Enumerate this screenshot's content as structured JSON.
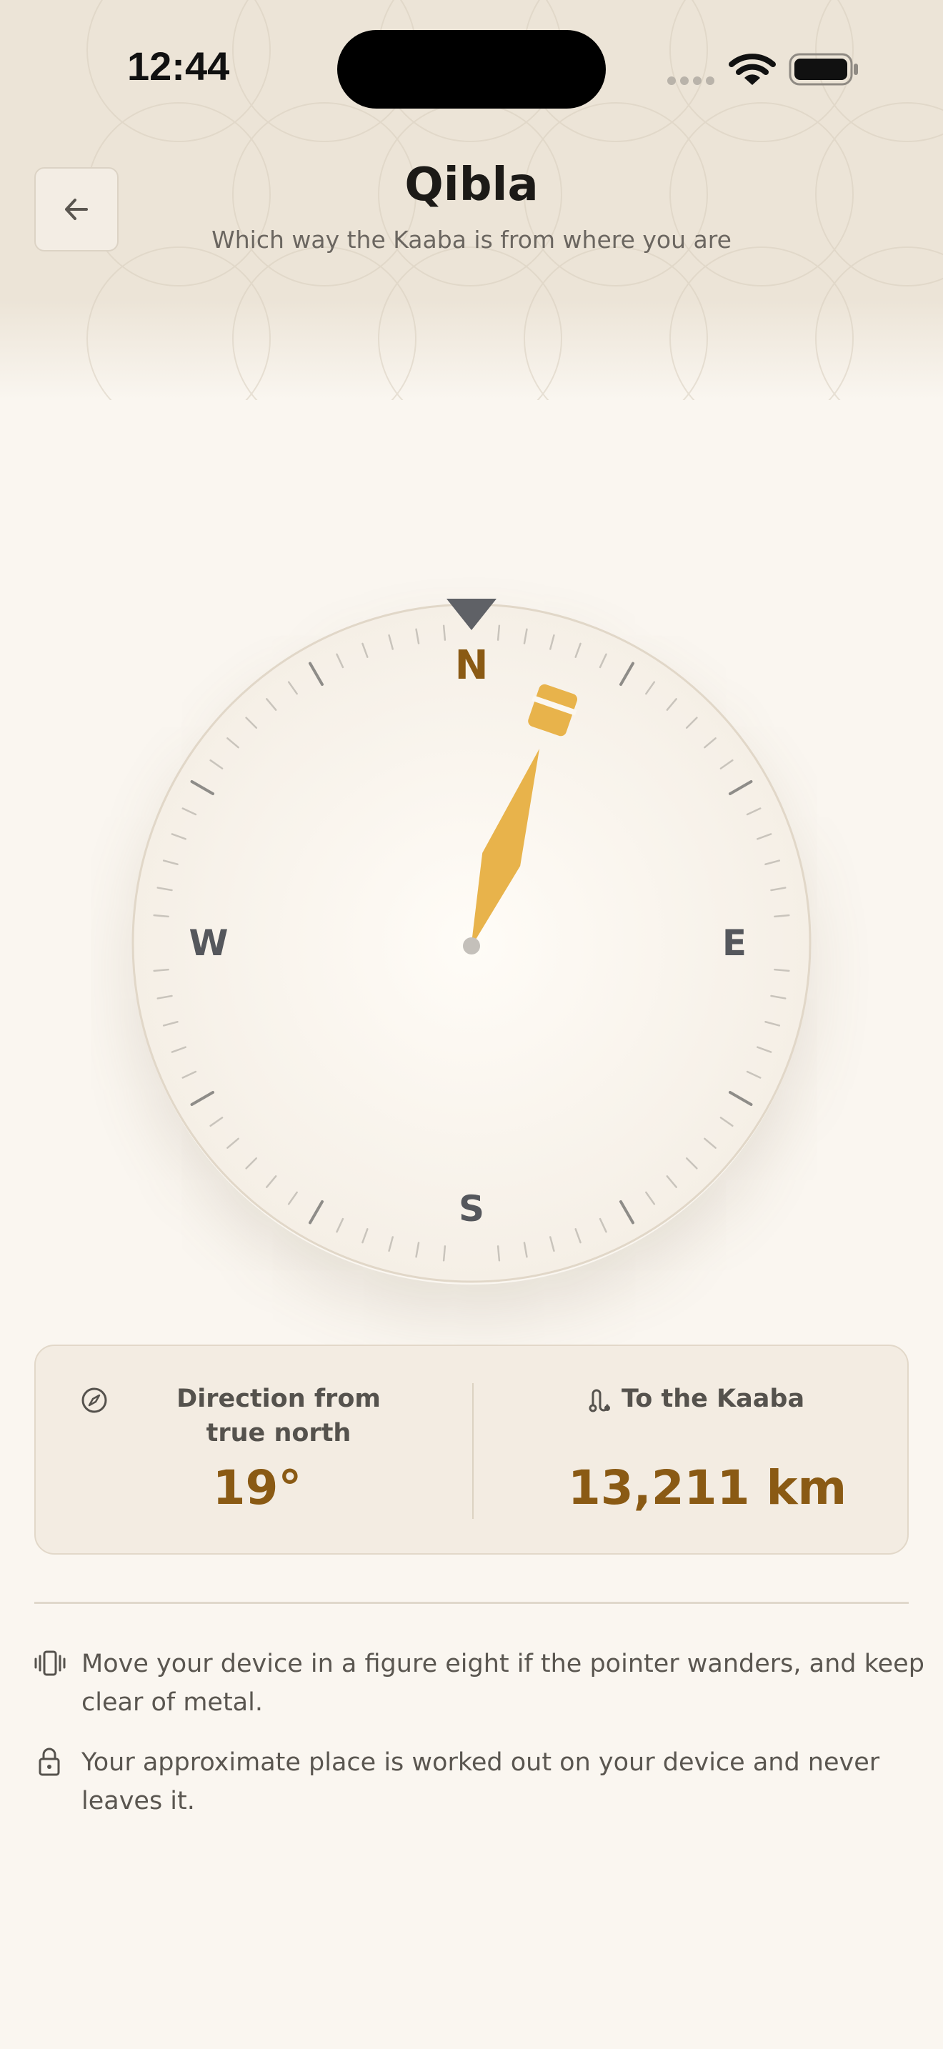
{
  "status_bar": {
    "time": "12:44"
  },
  "header": {
    "title": "Qibla",
    "subtitle": "Which way the Kaaba is from where you are"
  },
  "compass": {
    "cardinals": {
      "north": "N",
      "east": "E",
      "south": "S",
      "west": "W"
    },
    "qibla_bearing_deg": 19,
    "accent_color": "#e8b34b",
    "north_color": "#8a5a14"
  },
  "stats": {
    "direction_label": "Direction from true north",
    "direction_value": "19°",
    "distance_label": "To the Kaaba",
    "distance_value": "13,211 km"
  },
  "tips": [
    {
      "icon": "vibrate-phone-icon",
      "text": "Move your device in a figure eight if the pointer wanders, and keep clear of metal."
    },
    {
      "icon": "lock-icon",
      "text": "Your approximate place is worked out on your device and never leaves it."
    }
  ]
}
